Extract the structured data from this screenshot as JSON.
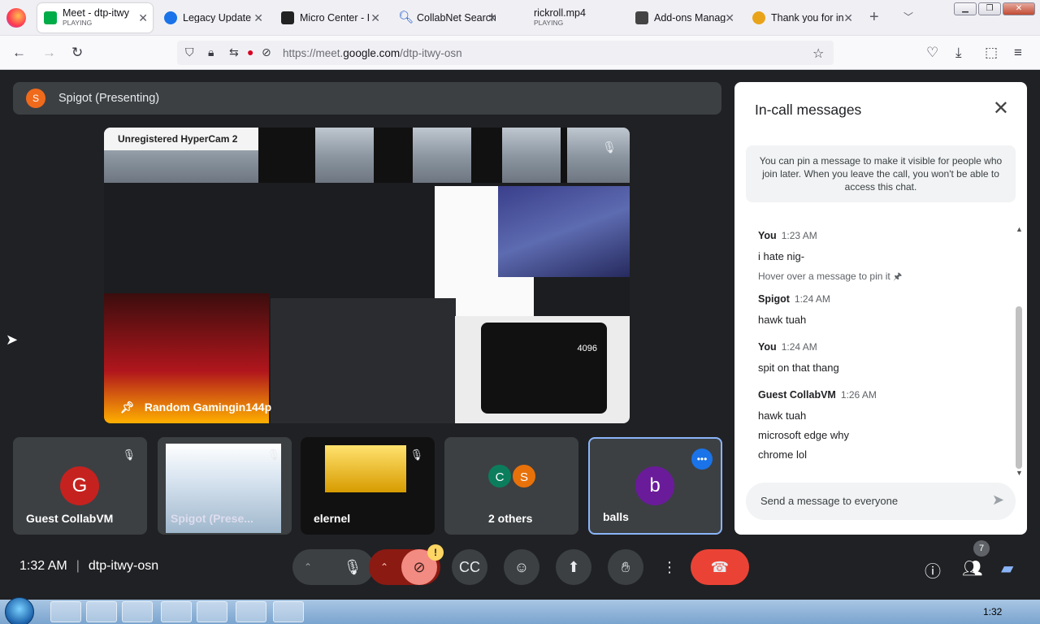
{
  "browser": {
    "tabs": [
      {
        "title": "Meet - dtp-itwy",
        "status": "PLAYING",
        "fav_color": "#00ac47"
      },
      {
        "title": "Legacy Update",
        "fav_color": "#1a73e8"
      },
      {
        "title": "Micro Center - I",
        "fav_color": "#222222"
      },
      {
        "title": "CollabNet Search",
        "fav_color": "#1a56c9"
      },
      {
        "title": "rickroll.mp4",
        "status": "PLAYING"
      },
      {
        "title": "Add-ons Manag",
        "fav_color": "#444444"
      },
      {
        "title": "Thank you for in",
        "fav_color": "#e9a319"
      }
    ],
    "new_tab": "+",
    "url_host_prefix": "https://meet.",
    "url_host": "google.com",
    "url_path": "/dtp-itwy-osn"
  },
  "meet": {
    "presenting_label": "Spigot (Presenting)",
    "presenter_initial": "S",
    "hypercam_label": "Unregistered HyperCam 2",
    "screen_name": "Random Gamingin144p",
    "calc_value": "4096",
    "tiles": [
      {
        "name": "Guest CollabVM",
        "initial": "G",
        "color": "#c5221f"
      },
      {
        "name": "Spigot (Prese..."
      },
      {
        "name": "elernel"
      },
      {
        "name": "2 others",
        "initials": [
          "C",
          "S"
        ],
        "colors": [
          "#0b7d5d",
          "#e8710a"
        ]
      },
      {
        "name": "balls",
        "initial": "b",
        "color": "#6a1b9a"
      }
    ],
    "time": "1:32 AM",
    "meeting_code": "dtp-itwy-osn",
    "people_count": "7",
    "cam_badge": "!"
  },
  "chat": {
    "title": "In-call messages",
    "pin_note": "You can pin a message to make it visible for people who join later. When you leave the call, you won't be able to access this chat.",
    "messages": [
      {
        "sender": "You",
        "time": "1:23 AM",
        "lines": [
          "i hate nig-"
        ],
        "hint": "Hover over a message to pin it 🖈"
      },
      {
        "sender": "Spigot",
        "time": "1:24 AM",
        "lines": [
          "hawk tuah"
        ]
      },
      {
        "sender": "You",
        "time": "1:24 AM",
        "lines": [
          "spit on that thang"
        ]
      },
      {
        "sender": "Guest CollabVM",
        "time": "1:26 AM",
        "lines": [
          "hawk tuah",
          "microsoft edge why",
          "chrome lol"
        ]
      }
    ],
    "input_placeholder": "Send a message to everyone"
  },
  "taskbar": {
    "clock": "1:32"
  }
}
